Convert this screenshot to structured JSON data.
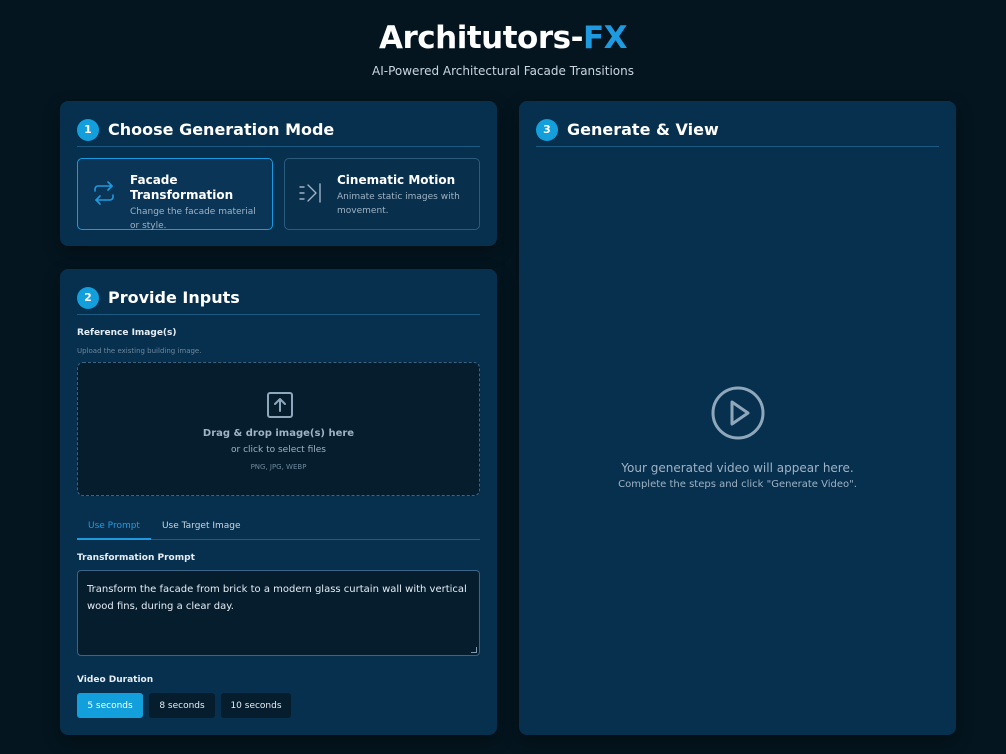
{
  "header": {
    "title_main": "Architutors-",
    "title_accent": "FX",
    "subtitle": "AI-Powered Architectural Facade Transitions"
  },
  "step1": {
    "number": "1",
    "title": "Choose Generation Mode",
    "modes": [
      {
        "name": "Facade Transformation",
        "desc": "Change the facade material or style.",
        "icon": "swap-arrows-icon",
        "selected": true
      },
      {
        "name": "Cinematic Motion",
        "desc": "Animate static images with movement.",
        "icon": "motion-arrow-icon",
        "selected": false
      }
    ]
  },
  "step2": {
    "number": "2",
    "title": "Provide Inputs",
    "reference_label": "Reference Image(s)",
    "reference_hint": "Upload the existing building image.",
    "dropzone": {
      "main": "Drag & drop image(s) here",
      "sub": "or click to select files",
      "types": "PNG, JPG, WEBP"
    },
    "tabs": [
      {
        "label": "Use Prompt",
        "active": true
      },
      {
        "label": "Use Target Image",
        "active": false
      }
    ],
    "prompt_label": "Transformation Prompt",
    "prompt_value": "Transform the facade from brick to a modern glass curtain wall with vertical wood fins, during a clear day.",
    "duration_label": "Video Duration",
    "durations": [
      {
        "label": "5 seconds",
        "active": true
      },
      {
        "label": "8 seconds",
        "active": false
      },
      {
        "label": "10 seconds",
        "active": false
      }
    ]
  },
  "step3": {
    "number": "3",
    "title": "Generate & View",
    "placeholder_main": "Your generated video will appear here.",
    "placeholder_sub": "Complete the steps and click \"Generate Video\"."
  },
  "colors": {
    "background": "#04151f",
    "panel": "#07304f",
    "accent": "#1e9be0",
    "step_badge": "#129fdb"
  }
}
